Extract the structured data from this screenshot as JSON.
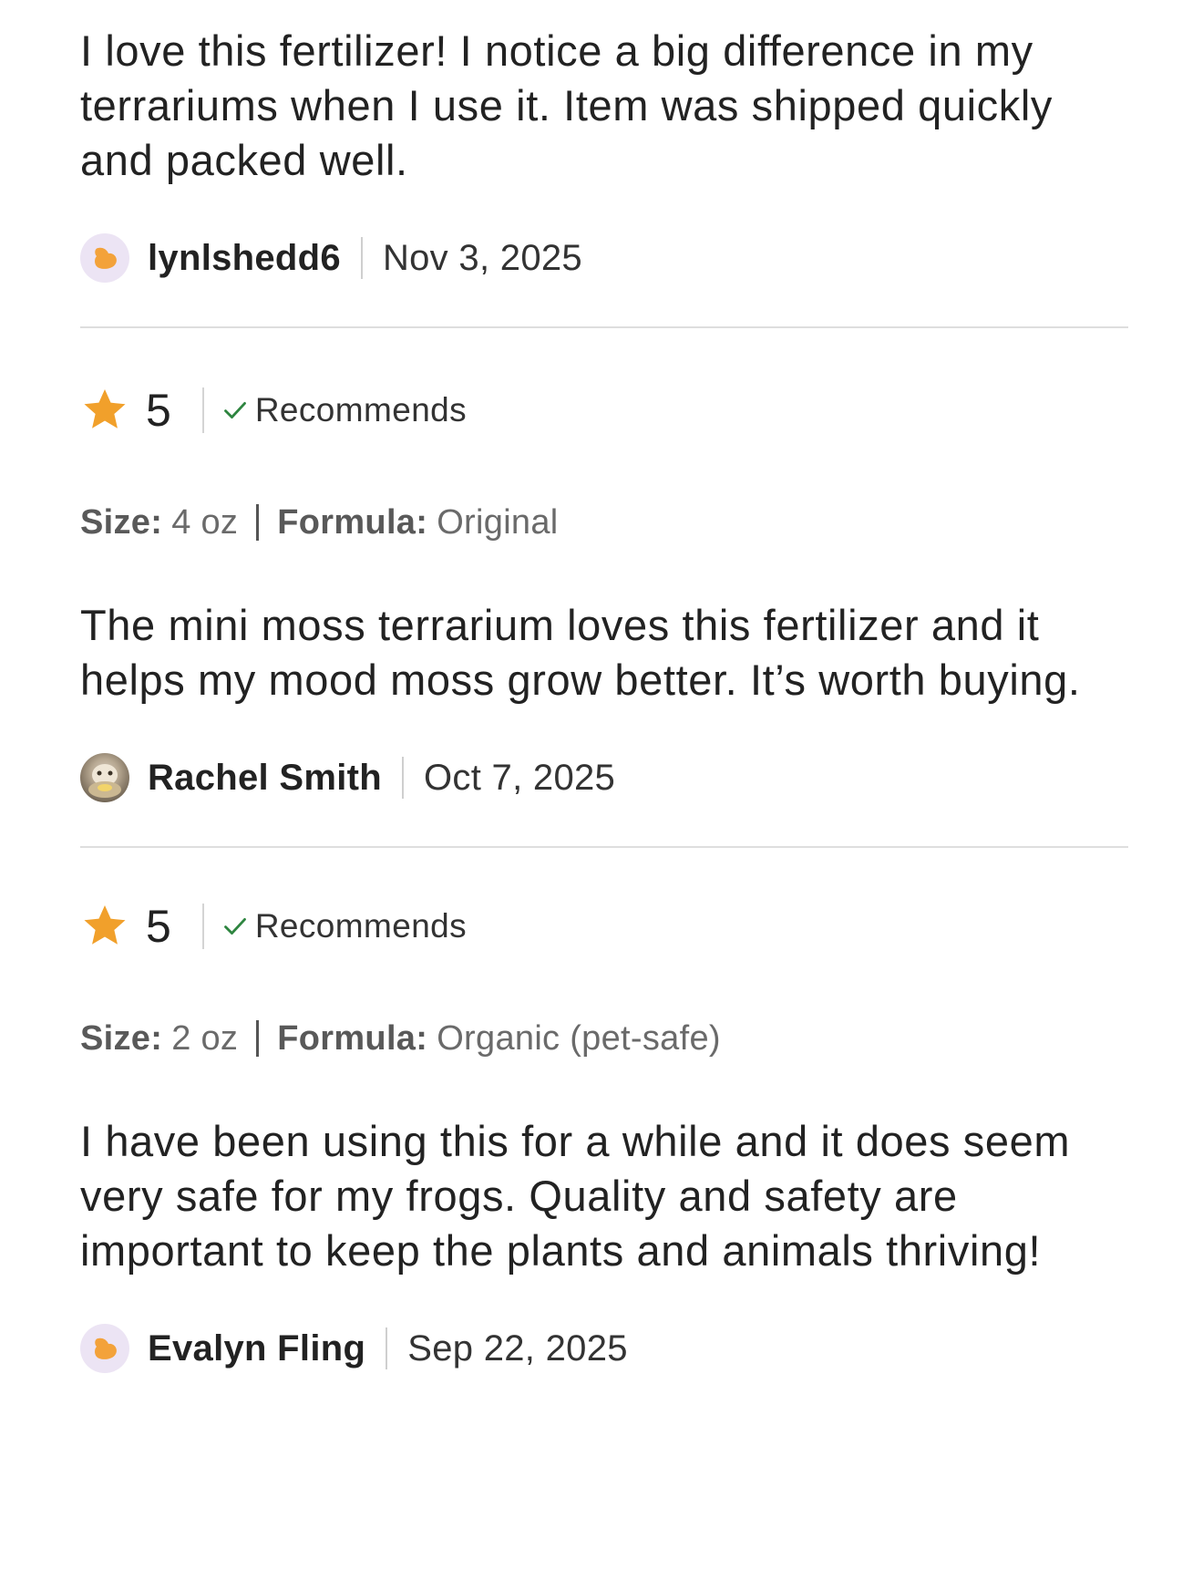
{
  "colors": {
    "star": "#f1a02b",
    "check": "#2e8540",
    "divider": "#dedede",
    "avatar_default_bg": "#ece4f4",
    "avatar_default_icon": "#f3a23a"
  },
  "reviews": [
    {
      "body": "I love this fertilizer! I notice a big difference in my terrariums when I use it. Item was shipped quickly and packed well.",
      "author": "lynlshedd6",
      "date": "Nov 3, 2025",
      "avatar_icon": "default-avatar-icon"
    },
    {
      "rating": "5",
      "recommends": "Recommends",
      "size_label": "Size:",
      "size_value": "4 oz",
      "formula_label": "Formula:",
      "formula_value": "Original",
      "body": "The mini moss terrarium loves this fertilizer and it helps my mood moss grow better. It’s worth buying.",
      "author": "Rachel Smith",
      "date": "Oct 7, 2025",
      "avatar_icon": "user-photo-avatar"
    },
    {
      "rating": "5",
      "recommends": "Recommends",
      "size_label": "Size:",
      "size_value": "2 oz",
      "formula_label": "Formula:",
      "formula_value": "Organic (pet-safe)",
      "body": "I have been using this for a while and it does seem very safe for my frogs. Quality and safety are important to keep the plants and animals thriving!",
      "author": "Evalyn Fling",
      "date": "Sep 22, 2025",
      "avatar_icon": "default-avatar-icon"
    }
  ]
}
